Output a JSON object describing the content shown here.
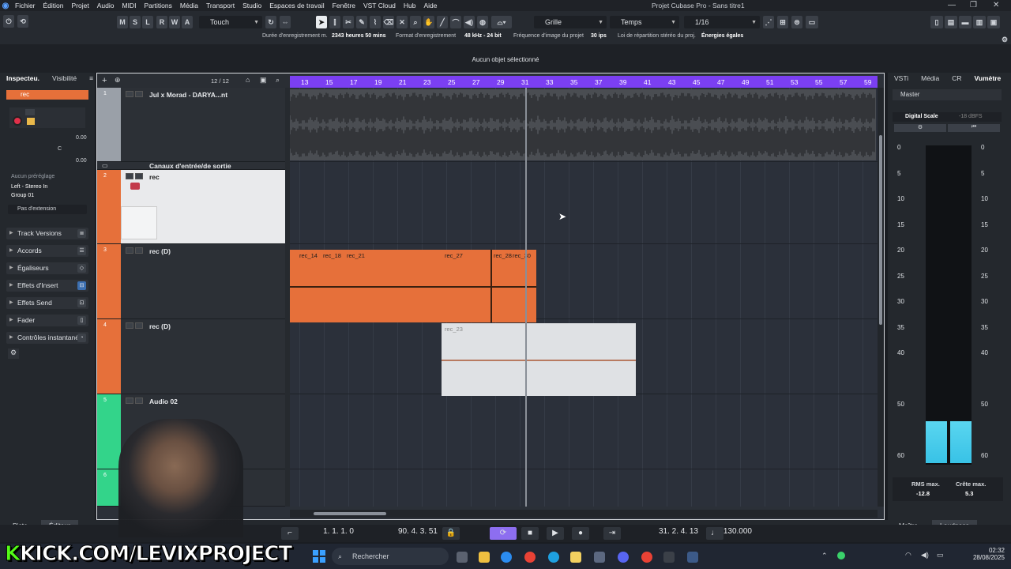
{
  "menubar": {
    "items": [
      "Fichier",
      "Édition",
      "Projet",
      "Audio",
      "MIDI",
      "Partitions",
      "Média",
      "Transport",
      "Studio",
      "Espaces de travail",
      "Fenêtre",
      "VST Cloud",
      "Hub",
      "Aide"
    ],
    "title": "Projet Cubase Pro - Sans titre1"
  },
  "toolbar": {
    "msrwa": [
      "M",
      "S",
      "L",
      "R",
      "W",
      "A"
    ],
    "automation_mode": "Touch",
    "snap_type": "Grille",
    "grid_type": "Temps",
    "quantize": "1/16"
  },
  "infoline": {
    "rec_time_label": "Durée d'enregistrement m.",
    "rec_time_value": "2343 heures 50 mins",
    "rec_format_label": "Format d'enregistrement",
    "rec_format_value": "48 kHz - 24 bit",
    "framerate_label": "Fréquence d'image du projet",
    "framerate_value": "30 ips",
    "pan_law_label": "Loi de répartition stéréo du proj.",
    "pan_law_value": "Énergies égales"
  },
  "status": {
    "message": "Aucun objet sélectionné"
  },
  "inspector": {
    "tabs": [
      "Inspecteu.",
      "Visibilité"
    ],
    "track_name": "rec",
    "vol_value": "0.00",
    "pan_value": "C",
    "delay_value": "0.00",
    "preset": "Aucun préréglage",
    "input": "Left - Stereo In",
    "output": "Group 01",
    "extension": "Pas d'extension",
    "sections": [
      "Track Versions",
      "Accords",
      "Égaliseurs",
      "Effets d'Insert",
      "Effets Send",
      "Fader",
      "Contrôles instantanés"
    ]
  },
  "project": {
    "track_count": "12 / 12",
    "ruler": [
      "13",
      "15",
      "17",
      "19",
      "21",
      "23",
      "25",
      "27",
      "29",
      "31",
      "33",
      "35",
      "37",
      "39",
      "41",
      "43",
      "45",
      "47",
      "49",
      "51",
      "53",
      "55",
      "57",
      "59"
    ],
    "tracks": [
      {
        "num": "1",
        "name": "Jul x Morad - DARYA...nt",
        "color": "#9aa0a8"
      },
      {
        "num": "",
        "name": "Canaux d'entrée/de sortie",
        "color": "#2c3036"
      },
      {
        "num": "2",
        "name": "rec",
        "color": "#e6703a"
      },
      {
        "num": "3",
        "name": "rec (D)",
        "color": "#e6703a"
      },
      {
        "num": "4",
        "name": "rec (D)",
        "color": "#e6703a"
      },
      {
        "num": "5",
        "name": "Audio 02",
        "color": "#33d48a"
      },
      {
        "num": "6",
        "name": "",
        "color": "#33d48a"
      }
    ],
    "events": {
      "orange": [
        "rec_14",
        "rec_18",
        "rec_21",
        "rec_27",
        "rec_28",
        "rec_30"
      ],
      "grey": "rec_23"
    }
  },
  "rightzone": {
    "tabs": [
      "VSTi",
      "Média",
      "CR",
      "Vumètre"
    ],
    "channel": "Master",
    "scale_label": "Digital Scale",
    "scale_value": "-18 dBFS",
    "scale_marks": [
      "0",
      "5",
      "10",
      "15",
      "20",
      "25",
      "30",
      "35",
      "40",
      "50",
      "60"
    ],
    "rms_label": "RMS max.",
    "rms_value": "-12.8",
    "peak_label": "Crête max.",
    "peak_value": "5.3",
    "rms_level": 0.13,
    "bottom_tabs": [
      "Maître",
      "Loudness"
    ]
  },
  "bottom_tabs": [
    "Piste",
    "Éditeur"
  ],
  "transport": {
    "left_locator": "1. 1. 1. 0",
    "right_locator": "90. 4. 3. 51",
    "position": "31. 2. 4. 13",
    "tempo": "130.000"
  },
  "taskbar": {
    "search": "Rechercher",
    "time": "02:32",
    "date": "28/08/2025"
  },
  "overlay": {
    "kick_prefix": "K",
    "kick_text": "KICK.COM/LEVIXPROJECT"
  }
}
